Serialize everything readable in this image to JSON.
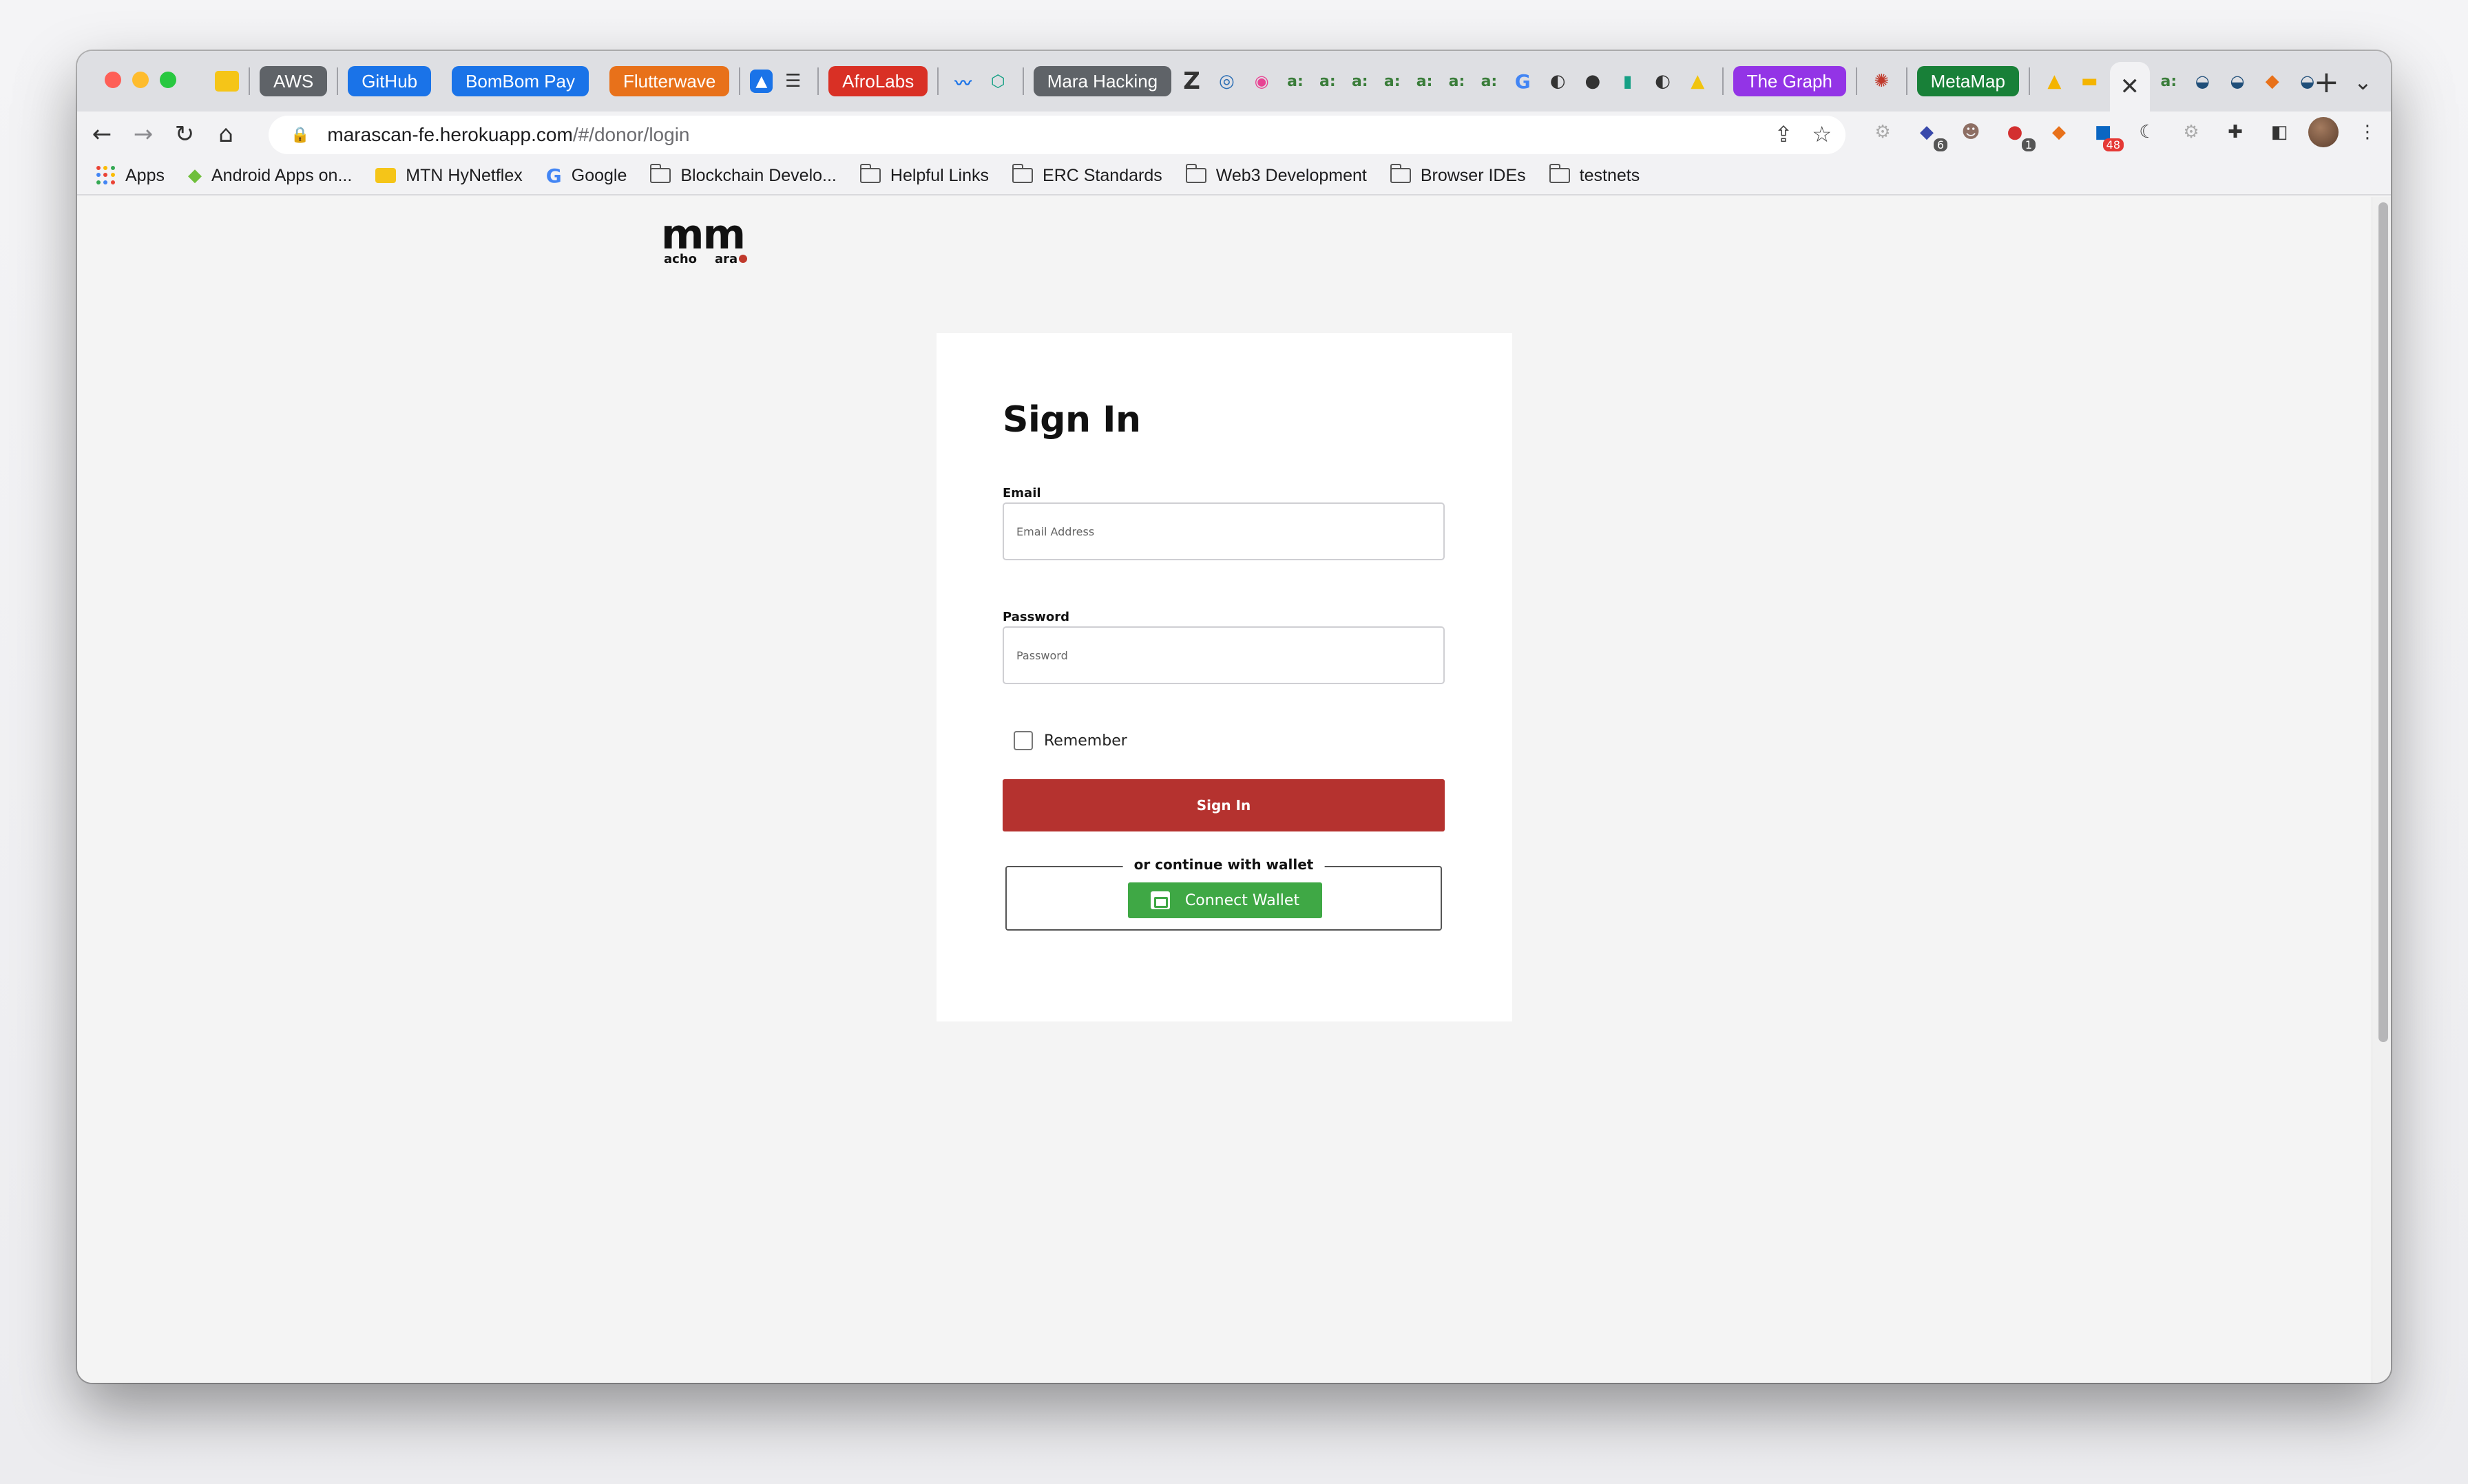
{
  "tabs": {
    "aws": {
      "label": "AWS",
      "color": "#5f6368"
    },
    "github": {
      "label": "GitHub",
      "color": "#1a73e8"
    },
    "bombom": {
      "label": "BomBom Pay",
      "color": "#1a73e8"
    },
    "flutterwave": {
      "label": "Flutterwave",
      "color": "#e8711a"
    },
    "afrolabs": {
      "label": "AfroLabs",
      "color": "#d93025"
    },
    "mara": {
      "label": "Mara Hacking",
      "color": "#5f6368"
    },
    "thegraph": {
      "label": "The Graph",
      "color": "#9334e6"
    },
    "metamap": {
      "label": "MetaMap",
      "color": "#188038"
    },
    "active_close": "✕",
    "new_tab": "+",
    "z_icon": "Z",
    "small_tab_glyph": "a:"
  },
  "toolbar": {
    "url_host": "marascan-fe.herokuapp.com",
    "url_path": "/#/donor/login",
    "ext_badges": {
      "b1": "6",
      "b2": "1",
      "b3": "48"
    }
  },
  "bookmarks": [
    {
      "label": "Apps",
      "icon": "apps-grid-icon"
    },
    {
      "label": "Android Apps on...",
      "icon": "android-icon"
    },
    {
      "label": "MTN HyNetflex",
      "icon": "mtn-icon"
    },
    {
      "label": "Google",
      "icon": "google-icon"
    },
    {
      "label": "Blockchain Develo...",
      "icon": "folder-icon"
    },
    {
      "label": "Helpful Links",
      "icon": "folder-icon"
    },
    {
      "label": "ERC Standards",
      "icon": "folder-icon"
    },
    {
      "label": "Web3 Development",
      "icon": "folder-icon"
    },
    {
      "label": "Browser IDEs",
      "icon": "folder-icon"
    },
    {
      "label": "testnets",
      "icon": "folder-icon"
    }
  ],
  "logo": {
    "big": "mm",
    "left_small": "acho",
    "right_small": "ara"
  },
  "signin": {
    "title": "Sign In",
    "email_label": "Email",
    "email_placeholder": "Email Address",
    "email_value": "",
    "password_label": "Password",
    "password_placeholder": "Password",
    "password_value": "",
    "remember_label": "Remember",
    "remember_checked": false,
    "submit_label": "Sign In",
    "wallet_caption": "or continue with wallet",
    "wallet_button": "Connect Wallet"
  },
  "colors": {
    "primary_red": "#b5322f",
    "wallet_green": "#3fa845",
    "page_bg": "#f4f4f4"
  }
}
